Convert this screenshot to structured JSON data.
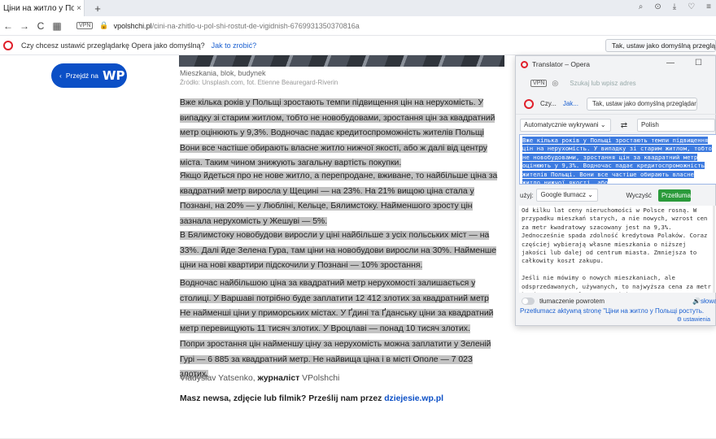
{
  "browser": {
    "tab_title": "Ціни на житло у Польщі р",
    "tab_close": "×",
    "new_tab": "+",
    "nav_back": "←",
    "nav_forward": "→",
    "nav_reload": "C",
    "vpn_badge": "VPN",
    "url_domain": "vpolshchi.pl",
    "url_path": "/cini-na-zhitlo-u-pol-shi-rostut-de-vigidnish-6769931350370816a"
  },
  "infobar": {
    "message": "Czy chcesz ustawić przeglądarkę Opera jako domyślną?",
    "link": "Jak to zrobić?",
    "button": "Tak, ustaw jako domyślną przeglądarkę"
  },
  "page": {
    "wp_button_label": "Przejdź na",
    "wp_logo": "WP",
    "caption": "Mieszkania, blok, budynek",
    "credit": "Źródło: Unsplash.com, fot. Etienne Beauregard-Riverin",
    "paragraphs": [
      "Вже кілька років у Польщі зростають темпи підвищення цін на нерухомість. У випадку зі старим житлом, тобто не новобудовами, зростання цін за квадратний метр оцінюють у 9,3%. Водночас падає кредитоспроможність жителів Польщі Вони все частіше обирають власне житло нижчої якості, або ж далі від центру міста. Таким чином знижують загальну вартість покупки.",
      "Якщо йдеться про не нове житло, а перепродане, вживане, то найбільше ціна за квадратний метр виросла у Щецині — на 23%. На 21% вищою ціна стала у Познані, на 20% — у Любліні, Кельце, Бялимстоку. Найменшого зросту цін зазнала нерухомість у Жешуві — 5%.",
      "В Бялимстоку новобудови виросли у ціні найбільше з усіх польських міст — на 33%. Далі йде Зелена Гура, там ціни на новобудови виросли на 30%. Найменше ціни на нові квартири підскочили у Познані — 10% зростання.",
      "Водночас найбільшою ціна за квадратний метр нерухомості залишається у столиці. У Варшаві потрібно буде заплатити 12 412 злотих за квадратний метр Не найменші ціни у приморських містах. У Ґдині та Ґданську ціни за квадратний метр перевищують 11 тисяч злотих. У Вроцлаві — понад 10 тисяч злотих.",
      "Попри зростання цін найменшу ціну за нерухомість можна заплатити у Зеленій Гурі — 6 885 за квадратний метр. Не найвища ціна і в місті Ополе — 7 023 злотих."
    ],
    "author_name": "Vladyslav Yatsenko,",
    "author_role": "журналіст",
    "author_outlet": "VPolshchi",
    "cta_text": "Masz newsa, zdjęcie lub filmik? Prześlij nam przez",
    "cta_link": "dziejesie.wp.pl"
  },
  "translator": {
    "window_title": "Translator – Opera",
    "minimize": "—",
    "maximize": "☐",
    "vpn_badge": "VPN",
    "search_placeholder": "Szukaj lub wpisz adres",
    "info_short": "Czy...",
    "info_link": "Jak...",
    "info_button": "Tak, ustaw jako domyślną przeglądarkę",
    "source_lang": "Automatycznie wykrywani",
    "swap": "⇄",
    "target_lang": "Polish",
    "source_text": "Вже кілька років у Польщі зростають темпи підвищення цін на нерухомість. У випадку зі старим житлом, тобто не новобудовами, зростання цін за квадратний метр оцінюють у 9,3%. Водночас падає кредитоспроможність жителів Польщі. Вони все частіше обирають власне житло нижчої якості, або",
    "engine_label": "użyj:",
    "engine": "Google tłumacz",
    "clear_button": "Wyczyść",
    "translate_button": "Przetłumacz",
    "output_text": "Od kilku lat ceny nieruchomości w Polsce rosną. W przypadku mieszkań starych, a nie nowych, wzrost cen za metr kwadratowy szacowany jest na 9,3%. Jednocześnie spada zdolność kredytowa Polaków. Coraz częściej wybierają własne mieszkania o niższej jakości lub dalej od centrum miasta. Zmniejsza to całkowity koszt zakupu.\n\nJeśli nie mówimy o nowych mieszkaniach, ale odsprzedawanych, używanych, to najwyższa cena za metr kwadratowy wzrosła w Szczecinie – o 23%. Cena",
    "auto_toggle_label": "tłumaczenie powrotem",
    "listen_label": "słowa",
    "translate_page_link": "Przetłumacz aktywną stronę \"Ціни на житло у Польщі ростуть.",
    "settings_link": "ustawienia"
  }
}
